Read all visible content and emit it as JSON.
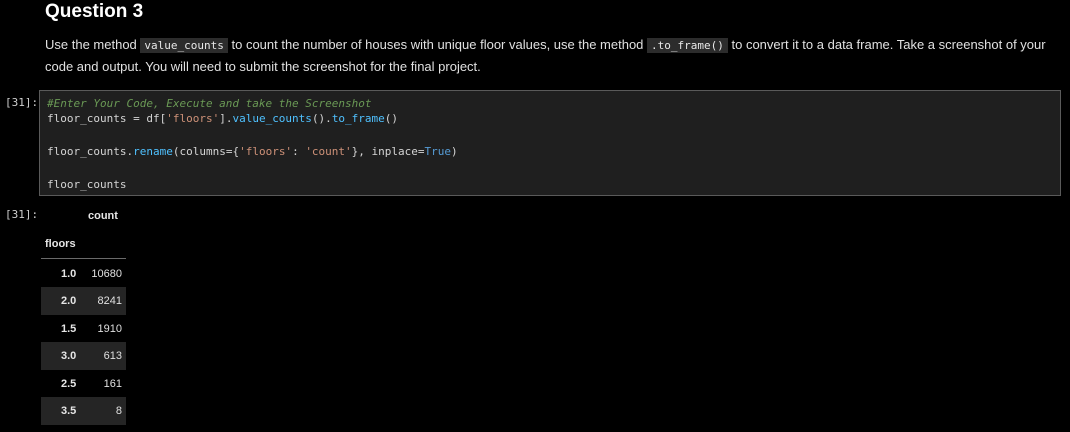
{
  "question": {
    "title": "Question 3",
    "text_part1": "Use the method ",
    "code1": "value_counts",
    "text_part2": " to count the number of houses with unique floor values, use the method ",
    "code2": ".to_frame()",
    "text_part3": " to convert it to a data frame. Take a screenshot of your code and output. You will need to submit the screenshot for the final project."
  },
  "input_cell": {
    "prompt": "[31]:",
    "line1_comment": "#Enter Your Code, Execute and take the Screenshot",
    "line2": {
      "a": "floor_counts ",
      "eq": "=",
      "b": " df[",
      "s": "'floors'",
      "c": "].",
      "f1": "value_counts",
      "d": "().",
      "f2": "to_frame",
      "e": "()"
    },
    "line3": {
      "a": "floor_counts.",
      "f1": "rename",
      "b": "(columns",
      "eq": "=",
      "c": "{",
      "s1": "'floors'",
      "d": ": ",
      "s2": "'count'",
      "e": "}, inplace",
      "eq2": "=",
      "k": "True",
      "f": ")"
    },
    "line4": "floor_counts"
  },
  "output_cell": {
    "prompt": "[31]:",
    "column_header": "count",
    "index_name": "floors",
    "rows": [
      {
        "index": "1.0",
        "value": "10680"
      },
      {
        "index": "2.0",
        "value": "8241"
      },
      {
        "index": "1.5",
        "value": "1910"
      },
      {
        "index": "3.0",
        "value": "613"
      },
      {
        "index": "2.5",
        "value": "161"
      },
      {
        "index": "3.5",
        "value": "8"
      }
    ]
  }
}
